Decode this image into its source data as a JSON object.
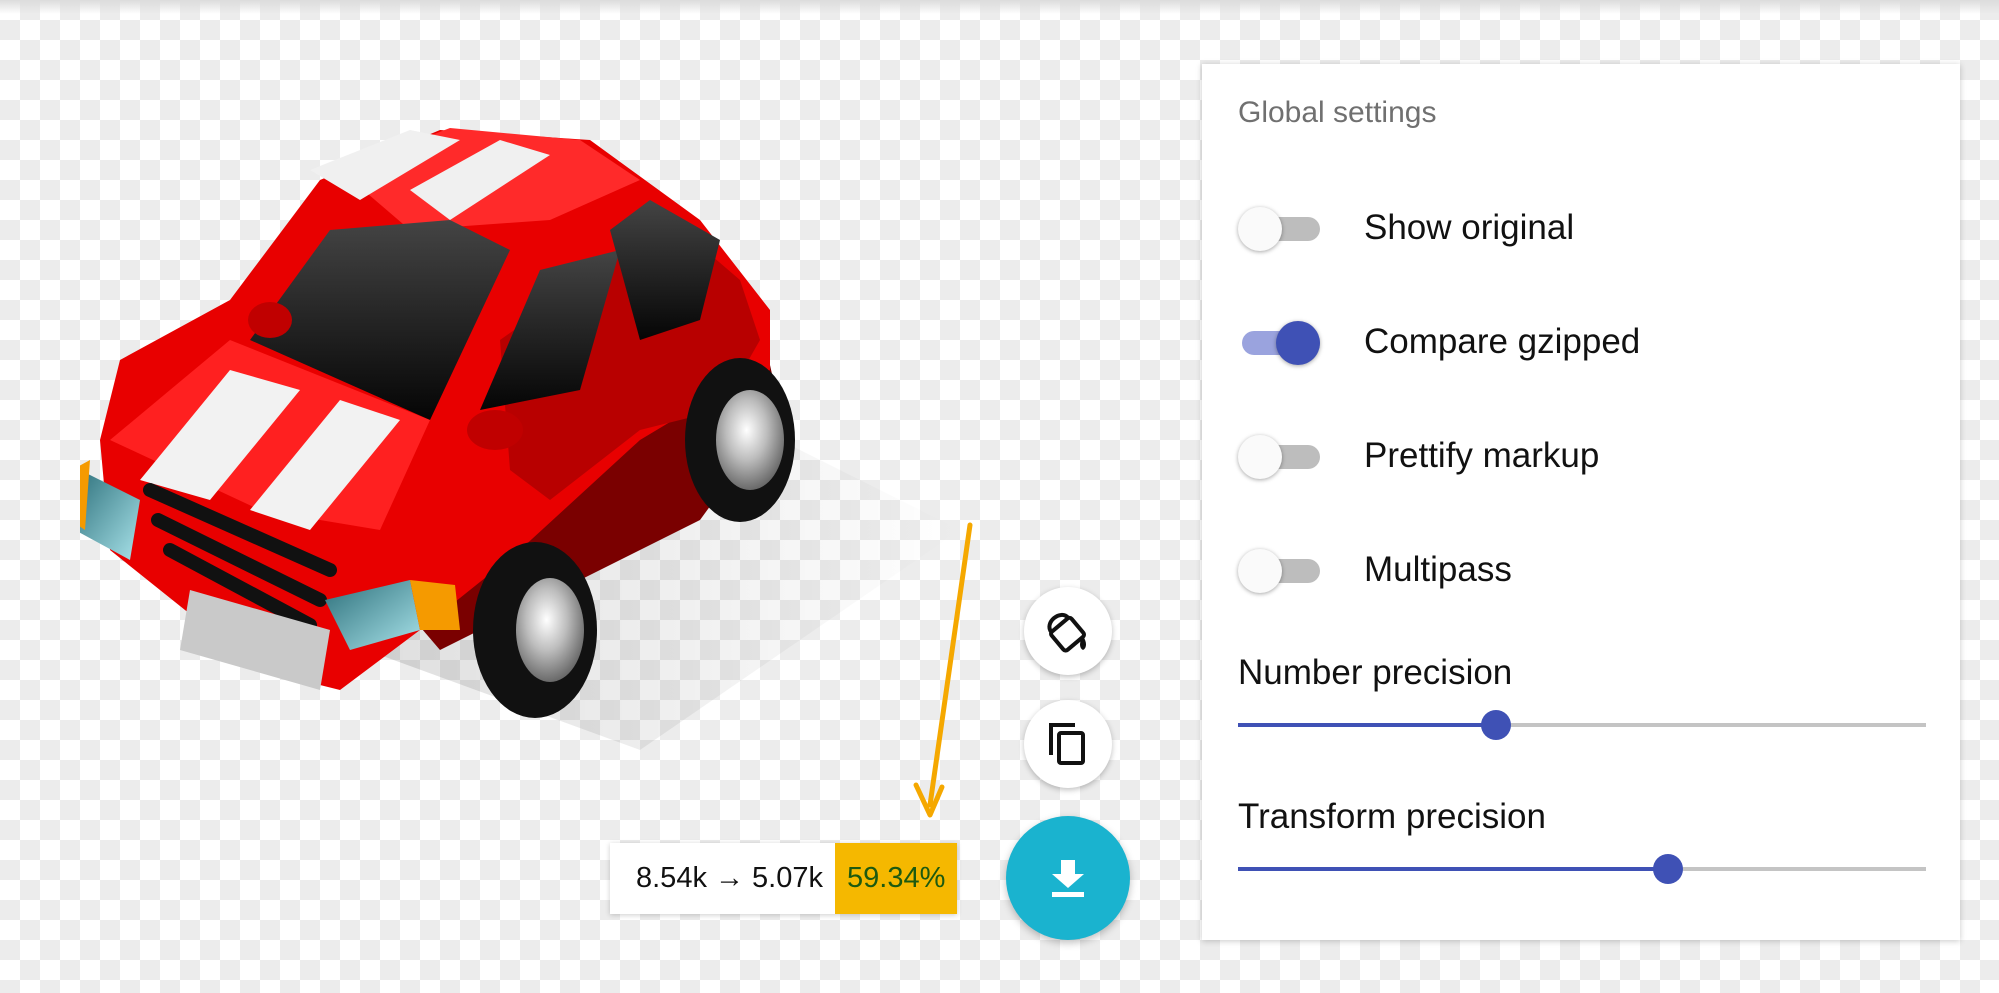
{
  "panel": {
    "title": "Global settings",
    "toggles": [
      {
        "label": "Show original",
        "on": false
      },
      {
        "label": "Compare gzipped",
        "on": true
      },
      {
        "label": "Prettify markup",
        "on": false
      },
      {
        "label": "Multipass",
        "on": false
      }
    ],
    "sliders": [
      {
        "label": "Number precision",
        "value_fraction": 0.375
      },
      {
        "label": "Transform precision",
        "value_fraction": 0.625
      }
    ]
  },
  "results": {
    "sizes": "8.54k → 5.07k",
    "percent": "59.34%"
  },
  "actions": {
    "background_icon": "paint-bucket-icon",
    "copy_icon": "copy-icon",
    "download_icon": "download-icon"
  },
  "colors": {
    "accent": "#3f51b5",
    "download_button": "#1ab3cf",
    "savings_badge": "#f5b800",
    "annotation_arrow": "#f5a800"
  }
}
